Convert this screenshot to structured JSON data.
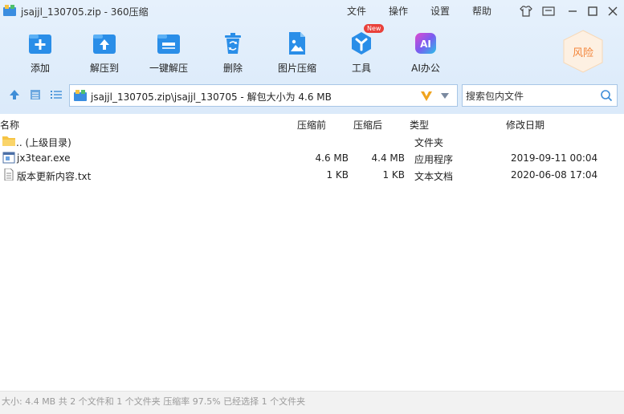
{
  "window": {
    "title": "jsajjl_130705.zip - 360压缩",
    "menu": [
      "文件",
      "操作",
      "设置",
      "帮助"
    ]
  },
  "toolbar": {
    "items": [
      {
        "label": "添加",
        "icon": "add-icon"
      },
      {
        "label": "解压到",
        "icon": "extract-to-icon"
      },
      {
        "label": "一键解压",
        "icon": "one-click-extract-icon"
      },
      {
        "label": "删除",
        "icon": "trash-icon"
      },
      {
        "label": "图片压缩",
        "icon": "image-compress-icon"
      },
      {
        "label": "工具",
        "icon": "tools-icon",
        "badge": "New"
      },
      {
        "label": "AI办公",
        "icon": "ai-office-icon"
      }
    ],
    "risk_label": "风险"
  },
  "nav": {
    "path": "jsajjl_130705.zip\\jsajjl_130705 - 解包大小为 4.6 MB",
    "search_placeholder": "搜索包内文件"
  },
  "list": {
    "columns": {
      "name": "名称",
      "before": "压缩前",
      "after": "压缩后",
      "type": "类型",
      "date": "修改日期"
    },
    "rows": [
      {
        "icon": "folder-icon",
        "name": ".. (上级目录)",
        "before": "",
        "after": "",
        "type": "文件夹",
        "date": ""
      },
      {
        "icon": "exe-file-icon",
        "name": "jx3tear.exe",
        "before": "4.6 MB",
        "after": "4.4 MB",
        "type": "应用程序",
        "date": "2019-09-11 00:04"
      },
      {
        "icon": "text-file-icon",
        "name": "版本更新内容.txt",
        "before": "1 KB",
        "after": "1 KB",
        "type": "文本文档",
        "date": "2020-06-08 17:04"
      }
    ]
  },
  "status": {
    "text": "大小: 4.4 MB 共 2 个文件和 1 个文件夹 压缩率 97.5% 已经选择 1 个文件夹"
  },
  "colors": {
    "accent": "#2a8ee8",
    "toolbar_bg": "#e3effb",
    "risk": "#f3853a",
    "badge": "#e9413b"
  }
}
